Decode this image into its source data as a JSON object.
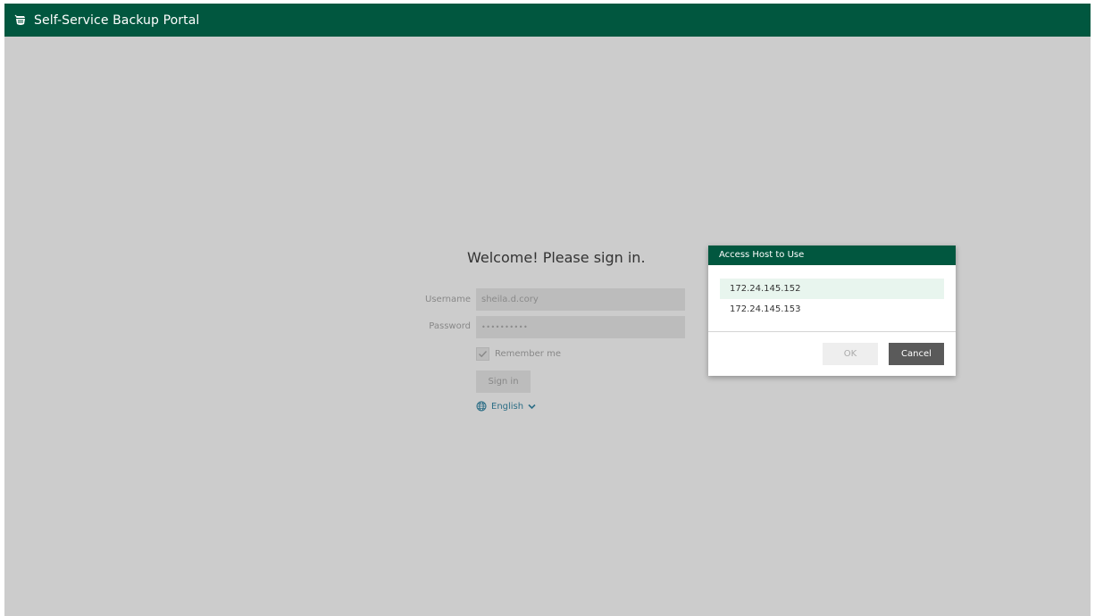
{
  "header": {
    "title": "Self-Service Backup Portal",
    "logo_icon": "backup-portal-logo-icon"
  },
  "login": {
    "heading": "Welcome! Please sign in.",
    "username_label": "Username",
    "username_value": "sheila.d.cory",
    "password_label": "Password",
    "password_value": "••••••••••",
    "remember_label": "Remember me",
    "remember_checked": true,
    "signin_label": "Sign in",
    "language_label": "English",
    "language_icon": "globe-icon"
  },
  "dialog": {
    "title": "Access Host to Use",
    "hosts": [
      {
        "label": "172.24.145.152",
        "selected": true
      },
      {
        "label": "172.24.145.153",
        "selected": false
      }
    ],
    "ok_label": "OK",
    "cancel_label": "Cancel"
  },
  "colors": {
    "brand": "#01573f",
    "background": "#cccccc",
    "link": "#2d6e86"
  }
}
